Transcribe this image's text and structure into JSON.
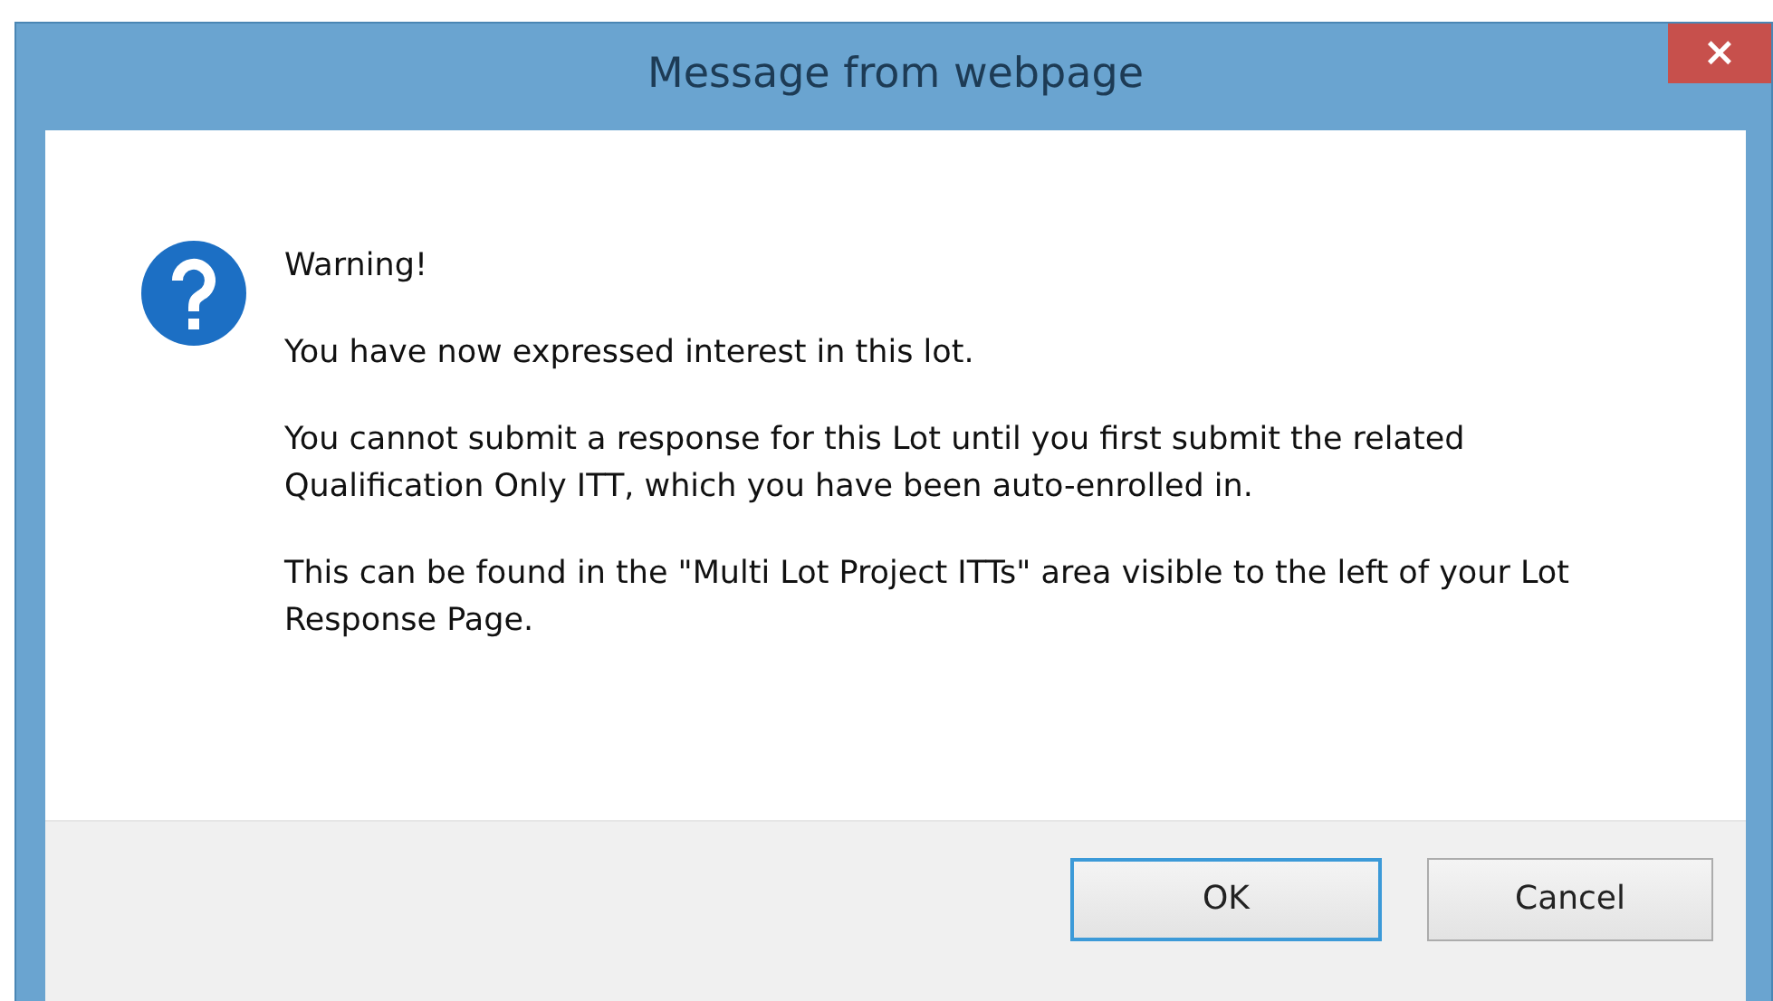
{
  "window": {
    "title": "Message from webpage",
    "close": "×"
  },
  "message": {
    "heading": "Warning!",
    "paragraphs": [
      "You have now expressed interest in this lot.",
      "You cannot submit a response for this Lot until you first submit the related Qualification Only ITT, which you have been auto-enrolled in.",
      "This can be found in the \"Multi Lot Project ITTs\" area visible to the left of your Lot Response Page."
    ]
  },
  "buttons": [
    {
      "label": "OK",
      "focused": true
    },
    {
      "label": "Cancel",
      "focused": false
    }
  ]
}
